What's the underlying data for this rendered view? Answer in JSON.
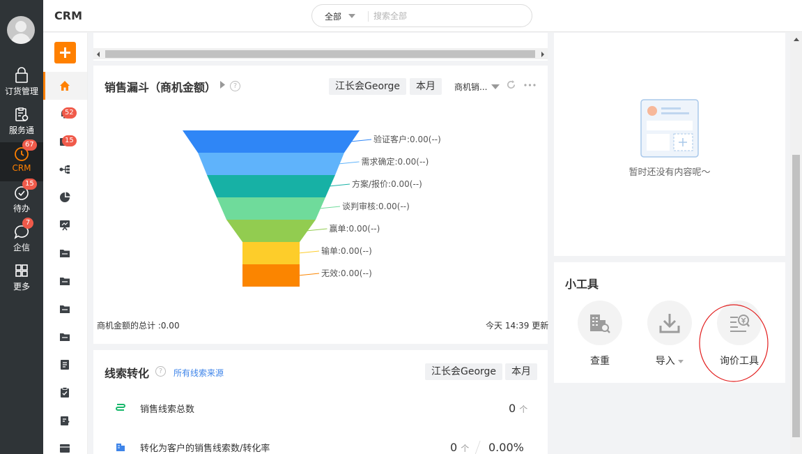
{
  "rail": {
    "items": [
      {
        "label": "订货管理"
      },
      {
        "label": "服务通"
      },
      {
        "label": "CRM",
        "badge": "67"
      },
      {
        "label": "待办",
        "badge": "15"
      },
      {
        "label": "企信",
        "badge": "7"
      },
      {
        "label": "更多"
      }
    ]
  },
  "header": {
    "title": "CRM",
    "search_scope": "全部",
    "search_placeholder": "搜索全部"
  },
  "side2": {
    "badges": [
      "52",
      "15"
    ]
  },
  "funnel": {
    "title": "销售漏斗（商机金额）",
    "help": "?",
    "owner_tag": "江长会George",
    "period_tag": "本月",
    "type_filter": "商机销...",
    "total_label": "商机金额的总计 :0.00",
    "updated_label": "今天 14:39 更新",
    "colors": [
      "#2f86f6",
      "#5fb3fb",
      "#17b1a5",
      "#6fdb9b",
      "#92cc50",
      "#fdcd2a",
      "#fb8500"
    ]
  },
  "chart_data": {
    "type": "funnel",
    "stages": [
      {
        "name": "验证客户",
        "label": "验证客户:0.00(--)",
        "value": 0.0
      },
      {
        "name": "需求确定",
        "label": "需求确定:0.00(--)",
        "value": 0.0
      },
      {
        "name": "方案/报价",
        "label": "方案/报价:0.00(--)",
        "value": 0.0
      },
      {
        "name": "谈判审核",
        "label": "谈判审核:0.00(--)",
        "value": 0.0
      },
      {
        "name": "赢单",
        "label": "赢单:0.00(--)",
        "value": 0.0
      },
      {
        "name": "输单",
        "label": "输单:0.00(--)",
        "value": 0.0
      },
      {
        "name": "无效",
        "label": "无效:0.00(--)",
        "value": 0.0
      }
    ]
  },
  "leads": {
    "title": "线索转化",
    "source_link": "所有线索来源",
    "owner_tag": "江长会George",
    "period_tag": "本月",
    "rows": [
      {
        "label": "销售线索总数",
        "value": "0",
        "unit": "个"
      },
      {
        "label": "转化为客户的销售线索数/转化率",
        "value": "0",
        "unit": "个",
        "rate": "0.00%"
      }
    ]
  },
  "empty": {
    "text": "暂时还没有内容呢～"
  },
  "tools": {
    "title": "小工具",
    "items": [
      {
        "label": "查重"
      },
      {
        "label": "导入"
      },
      {
        "label": "询价工具"
      }
    ]
  }
}
